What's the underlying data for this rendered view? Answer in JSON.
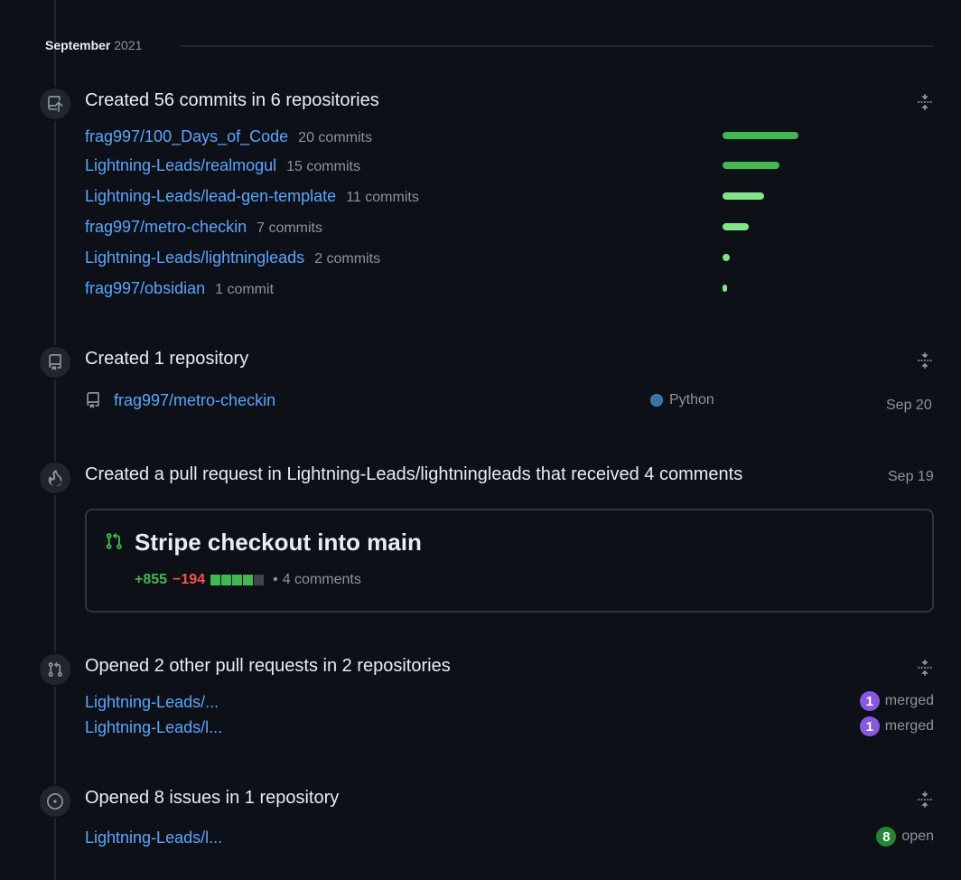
{
  "month": {
    "name": "September",
    "year": "2021"
  },
  "commits_section": {
    "title": "Created 56 commits in 6 repositories",
    "repos": [
      {
        "name": "frag997/100_Days_of_Code",
        "count": "20 commits",
        "commits": 20,
        "color": "#3fb950"
      },
      {
        "name": "Lightning-Leads/realmogul",
        "count": "15 commits",
        "commits": 15,
        "color": "#3fb950"
      },
      {
        "name": "Lightning-Leads/lead-gen-template",
        "count": "11 commits",
        "commits": 11,
        "color": "#7ee787"
      },
      {
        "name": "frag997/metro-checkin",
        "count": "7 commits",
        "commits": 7,
        "color": "#7ee787"
      },
      {
        "name": "Lightning-Leads/lightningleads",
        "count": "2 commits",
        "commits": 2,
        "color": "#7ee787"
      },
      {
        "name": "frag997/obsidian",
        "count": "1 commit",
        "commits": 1,
        "color": "#7ee787"
      }
    ]
  },
  "repo_section": {
    "title": "Created 1 repository",
    "repo": "frag997/metro-checkin",
    "language": "Python",
    "language_color": "#3572a5",
    "date": "Sep 20"
  },
  "pr_section": {
    "title": "Created a pull request in Lightning-Leads/lightningleads that received 4 comments",
    "date": "Sep 19",
    "pr_title": "Stripe checkout into main",
    "additions": "+855",
    "deletions": "−194",
    "comments": "4 comments",
    "diff_blocks": [
      "#3fb950",
      "#3fb950",
      "#3fb950",
      "#3fb950",
      "#3d444d"
    ]
  },
  "other_prs_section": {
    "title": "Opened 2 other pull requests in 2 repositories",
    "items": [
      {
        "repo": "Lightning-Leads/...",
        "count": "1",
        "state": "merged"
      },
      {
        "repo": "Lightning-Leads/l...",
        "count": "1",
        "state": "merged"
      }
    ]
  },
  "issues_section": {
    "title": "Opened 8 issues in 1 repository",
    "items": [
      {
        "repo": "Lightning-Leads/l...",
        "count": "8",
        "state": "open"
      }
    ]
  },
  "icons": {
    "commits": "repo-push-icon",
    "repository": "repo-icon",
    "pull_request_highlight": "flame-icon",
    "pull_request": "git-pull-request-icon",
    "issue": "issue-opened-icon",
    "collapse": "fold-icon"
  }
}
